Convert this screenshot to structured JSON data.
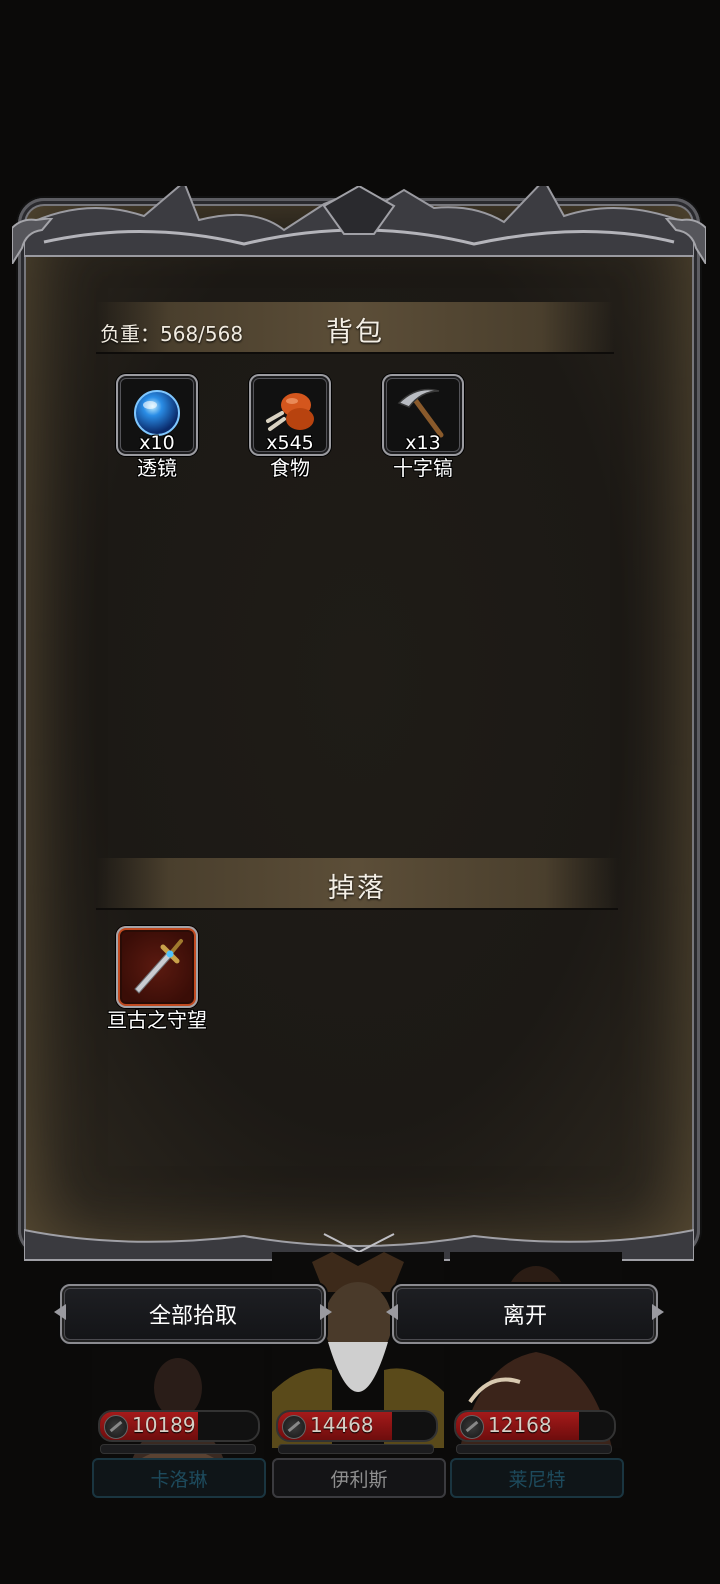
{
  "inventory": {
    "title": "背包",
    "weight_label": "负重：568/568",
    "items": [
      {
        "name": "透镜",
        "qty": "x10",
        "icon": "lens-icon"
      },
      {
        "name": "食物",
        "qty": "x545",
        "icon": "food-icon"
      },
      {
        "name": "十字镐",
        "qty": "x13",
        "icon": "pickaxe-icon"
      }
    ]
  },
  "drops": {
    "title": "掉落",
    "items": [
      {
        "name": "亘古之守望",
        "icon": "sword-icon",
        "rarity_color": "#c14a20"
      }
    ]
  },
  "actions": {
    "pickup_all": "全部拾取",
    "leave": "离开"
  },
  "party": [
    {
      "name": "卡洛琳",
      "hp": "10189",
      "hp_fraction": 0.62
    },
    {
      "name": "伊利斯",
      "hp": "14468",
      "hp_fraction": 0.72
    },
    {
      "name": "莱尼特",
      "hp": "12168",
      "hp_fraction": 0.78
    }
  ]
}
